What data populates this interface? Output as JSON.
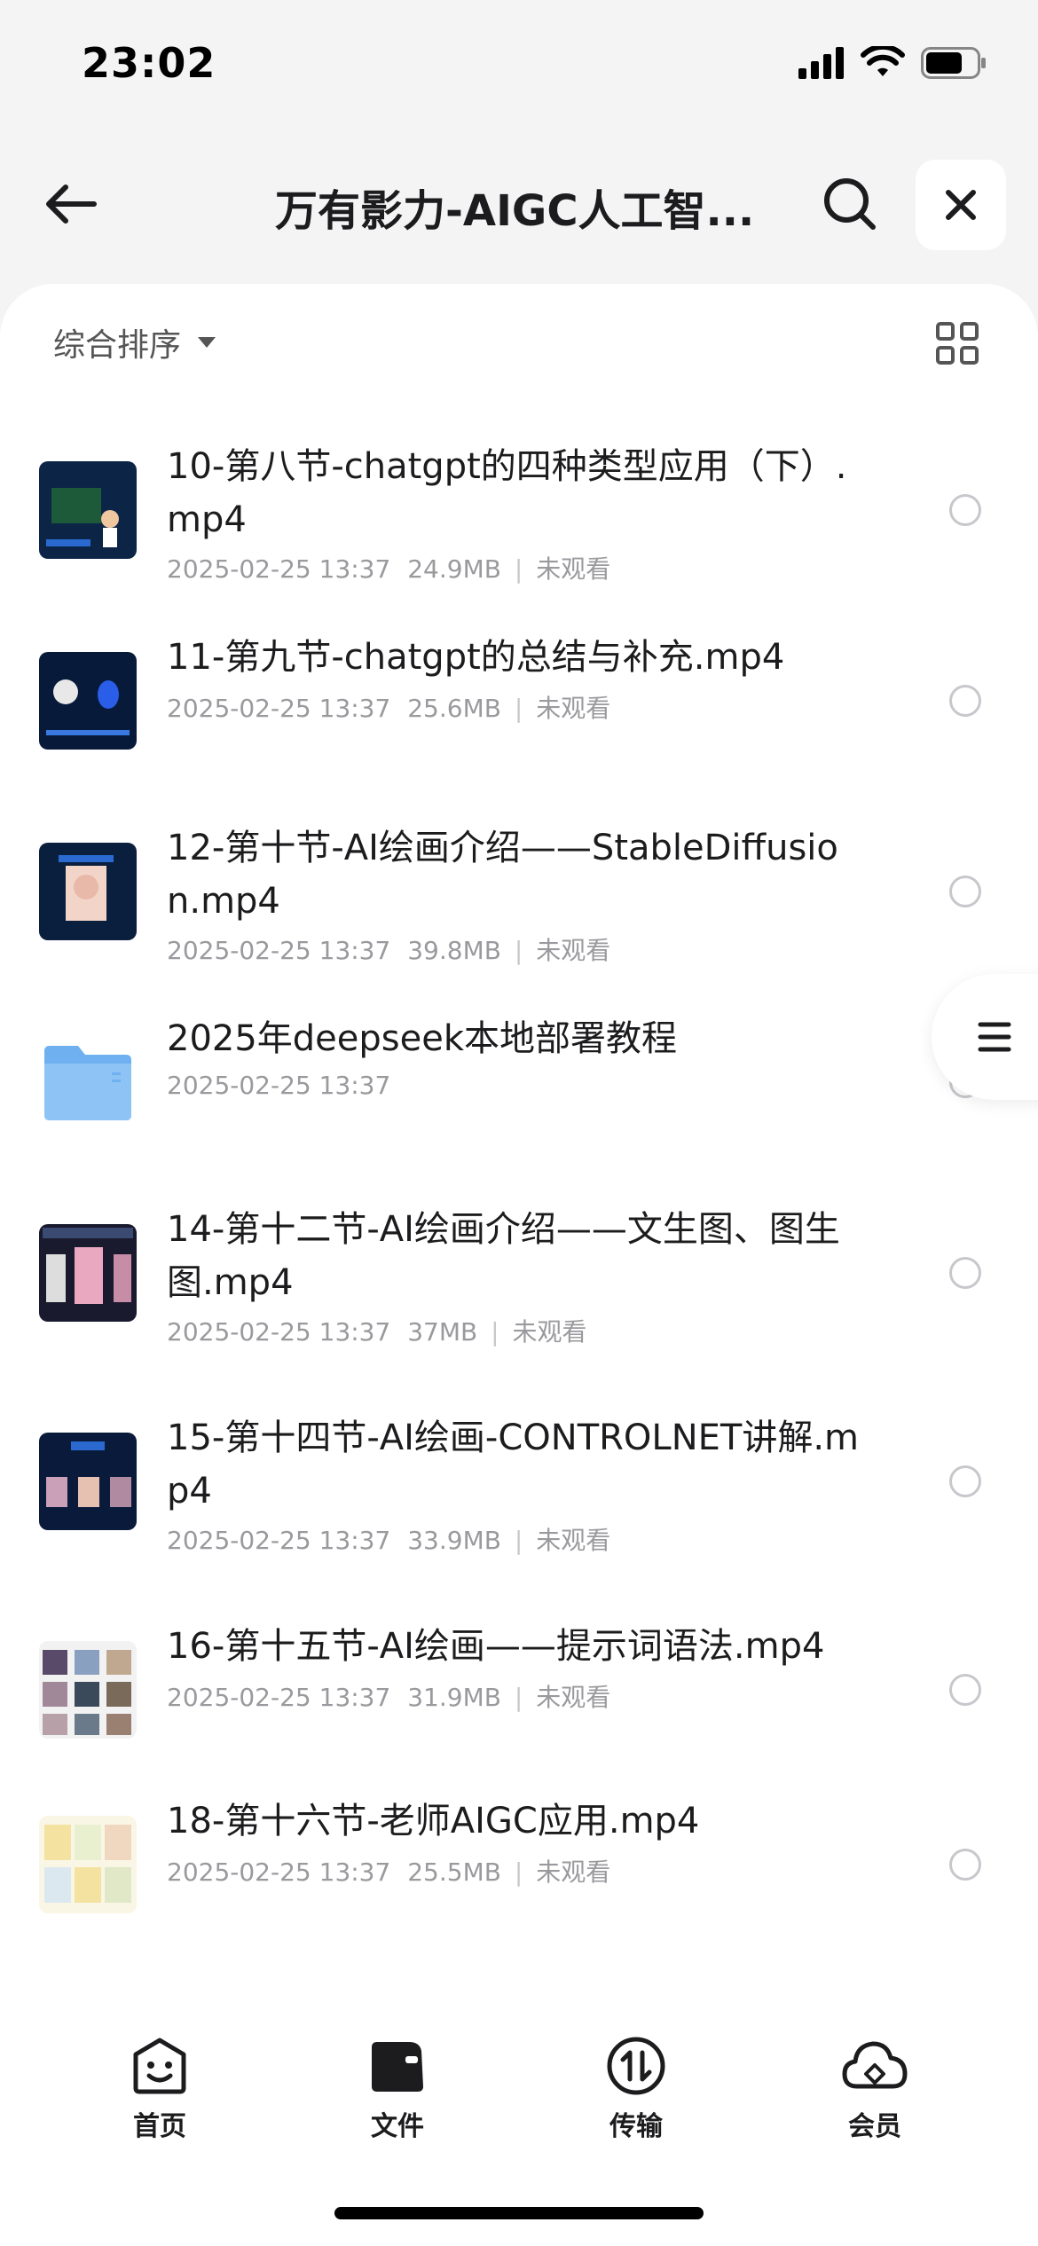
{
  "status_bar": {
    "time": "23:02"
  },
  "header": {
    "title": "万有影力-AIGC人工智..."
  },
  "toolbar": {
    "sort_label": "综合排序"
  },
  "files": [
    {
      "name": "10-第八节-chatgpt的四种类型应用（下）.mp4",
      "date": "2025-02-25 13:37",
      "size": "24.9MB",
      "status": "未观看",
      "thumb": "video"
    },
    {
      "name": "11-第九节-chatgpt的总结与补充.mp4",
      "date": "2025-02-25 13:37",
      "size": "25.6MB",
      "status": "未观看",
      "thumb": "video"
    },
    {
      "name": "12-第十节-AI绘画介绍——StableDiffusion.mp4",
      "date": "2025-02-25 13:37",
      "size": "39.8MB",
      "status": "未观看",
      "thumb": "video"
    },
    {
      "name": "2025年deepseek本地部署教程",
      "date": "2025-02-25 13:37",
      "thumb": "folder"
    },
    {
      "name": "14-第十二节-AI绘画介绍——文生图、图生图.mp4",
      "date": "2025-02-25 13:37",
      "size": "37MB",
      "status": "未观看",
      "thumb": "video"
    },
    {
      "name": "15-第十四节-AI绘画-CONTROLNET讲解.mp4",
      "date": "2025-02-25 13:37",
      "size": "33.9MB",
      "status": "未观看",
      "thumb": "video"
    },
    {
      "name": "16-第十五节-AI绘画——提示词语法.mp4",
      "date": "2025-02-25 13:37",
      "size": "31.9MB",
      "status": "未观看",
      "thumb": "video"
    },
    {
      "name": "18-第十六节-老师AIGC应用.mp4",
      "date": "2025-02-25 13:37",
      "size": "25.5MB",
      "status": "未观看",
      "thumb": "video"
    }
  ],
  "tabs": [
    {
      "label": "首页",
      "icon": "smile-face-icon"
    },
    {
      "label": "文件",
      "icon": "folder-icon"
    },
    {
      "label": "传输",
      "icon": "transfer-icon"
    },
    {
      "label": "会员",
      "icon": "cloud-icon"
    }
  ],
  "colors": {
    "accent_folder": "#6fb1f0",
    "background": "#f4f4f5",
    "muted_text": "#9a9a9e"
  }
}
